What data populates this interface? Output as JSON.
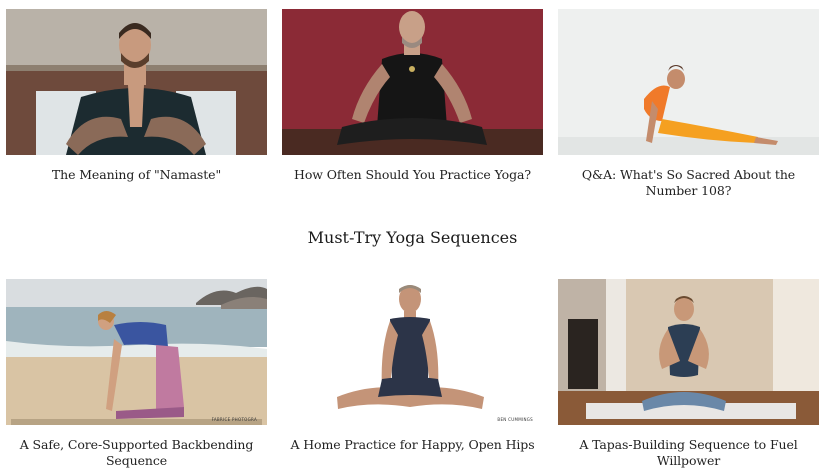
{
  "top_row": [
    {
      "caption": "The Meaning of \"Namaste\"",
      "image": "man-namaste-prayer-hands-photo"
    },
    {
      "caption": "How Often Should You Practice Yoga?",
      "image": "man-seated-meditation-photo"
    },
    {
      "caption": "Q&A: What's So Sacred About the Number 108?",
      "image": "woman-upward-dog-pose-photo"
    }
  ],
  "section": {
    "title": "Must-Try Yoga Sequences"
  },
  "bottom_row": [
    {
      "caption": "A Safe, Core-Supported Backbending Sequence",
      "image": "woman-camel-pose-beach-photo",
      "credit": "FABRICE PHOTOGRA"
    },
    {
      "caption": "A Home Practice for Happy, Open Hips",
      "image": "man-bound-angle-pose-photo",
      "credit": "BEN CUMMINGS"
    },
    {
      "caption": "A Tapas-Building Sequence to Fuel Willpower",
      "image": "woman-seated-prayer-living-room-photo"
    }
  ]
}
